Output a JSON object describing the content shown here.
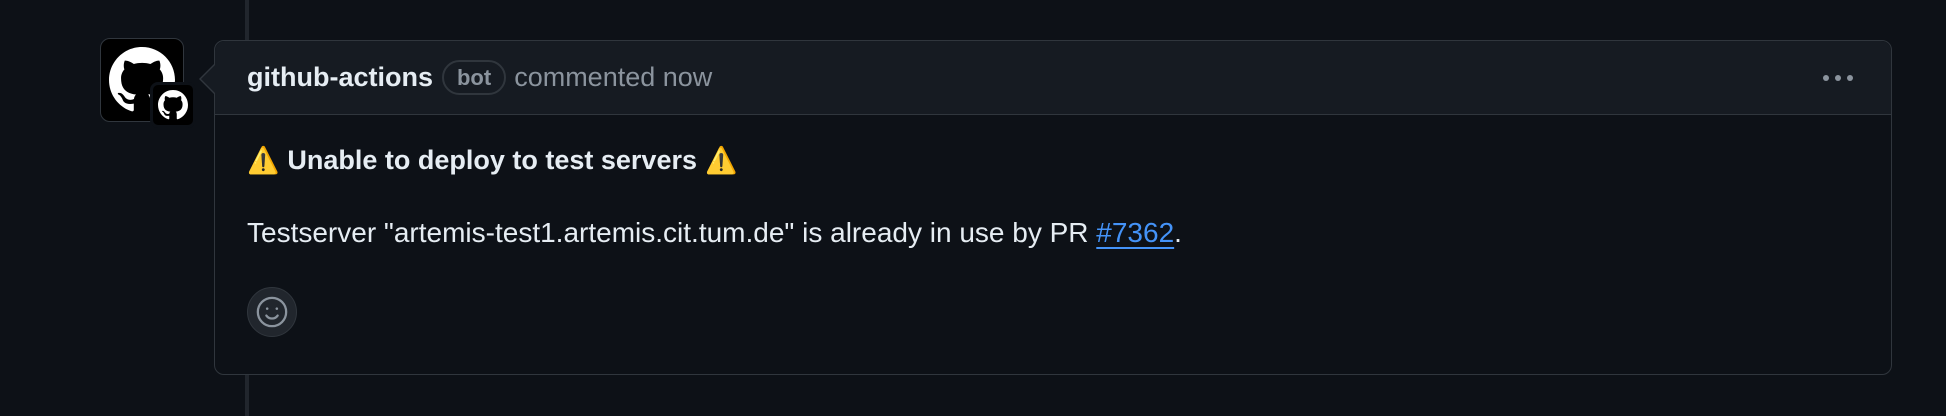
{
  "comment": {
    "author": "github-actions",
    "badge": "bot",
    "meta": "commented now",
    "heading_icon": "⚠️",
    "heading_text": "Unable to deploy to test servers",
    "body_prefix": "Testserver \"artemis-test1.artemis.cit.tum.de\" is already in use by PR ",
    "pr_link": "#7362",
    "body_suffix": "."
  },
  "icons": {
    "avatar": "github-octocat-icon",
    "badge": "github-octocat-icon",
    "menu": "kebab-horizontal-icon",
    "reaction": "smiley-icon"
  },
  "colors": {
    "background": "#0d1117",
    "header_background": "#161b22",
    "border": "#30363d",
    "text": "#e6edf3",
    "muted": "#8b949e",
    "link": "#4493f8"
  }
}
